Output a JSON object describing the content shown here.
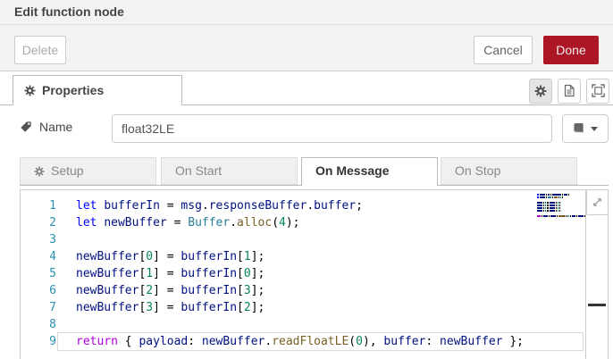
{
  "dialog": {
    "title": "Edit function node"
  },
  "actions": {
    "delete": "Delete",
    "cancel": "Cancel",
    "done": "Done"
  },
  "colors": {
    "done_bg": "#AD1625",
    "header_bg": "#f3f3f3",
    "active_tab_text": "#333",
    "inactive_tab_text": "#888",
    "line_number": "#2b91af"
  },
  "properties": {
    "tab_label": "Properties",
    "icon_buttons": [
      "gear-icon",
      "file-icon",
      "expand-frame-icon"
    ]
  },
  "name_field": {
    "label": "Name",
    "value": "float32LE"
  },
  "function_tabs": [
    {
      "label": "Setup",
      "icon": "gear",
      "active": false
    },
    {
      "label": "On Start",
      "icon": null,
      "active": false
    },
    {
      "label": "On Message",
      "icon": null,
      "active": true
    },
    {
      "label": "On Stop",
      "icon": null,
      "active": false
    }
  ],
  "editor": {
    "language": "javascript",
    "active_line": 9,
    "token_colors": {
      "kw": "#0000ff",
      "ctrl": "#af00db",
      "id": "#001080",
      "cls": "#267f99",
      "fn": "#795e26",
      "num": "#098658",
      "pl": "#000000"
    },
    "lines": [
      {
        "n": 1,
        "tokens": [
          [
            "kw",
            "let"
          ],
          [
            "pl",
            " "
          ],
          [
            "id",
            "bufferIn"
          ],
          [
            "pl",
            " = "
          ],
          [
            "id",
            "msg"
          ],
          [
            "pl",
            "."
          ],
          [
            "id",
            "responseBuffer"
          ],
          [
            "pl",
            "."
          ],
          [
            "id",
            "buffer"
          ],
          [
            "pl",
            ";"
          ]
        ]
      },
      {
        "n": 2,
        "tokens": [
          [
            "kw",
            "let"
          ],
          [
            "pl",
            " "
          ],
          [
            "id",
            "newBuffer"
          ],
          [
            "pl",
            " = "
          ],
          [
            "cls",
            "Buffer"
          ],
          [
            "pl",
            "."
          ],
          [
            "fn",
            "alloc"
          ],
          [
            "pl",
            "("
          ],
          [
            "num",
            "4"
          ],
          [
            "pl",
            ");"
          ]
        ]
      },
      {
        "n": 3,
        "tokens": []
      },
      {
        "n": 4,
        "tokens": [
          [
            "id",
            "newBuffer"
          ],
          [
            "pl",
            "["
          ],
          [
            "num",
            "0"
          ],
          [
            "pl",
            "] = "
          ],
          [
            "id",
            "bufferIn"
          ],
          [
            "pl",
            "["
          ],
          [
            "num",
            "1"
          ],
          [
            "pl",
            "];"
          ]
        ]
      },
      {
        "n": 5,
        "tokens": [
          [
            "id",
            "newBuffer"
          ],
          [
            "pl",
            "["
          ],
          [
            "num",
            "1"
          ],
          [
            "pl",
            "] = "
          ],
          [
            "id",
            "bufferIn"
          ],
          [
            "pl",
            "["
          ],
          [
            "num",
            "0"
          ],
          [
            "pl",
            "];"
          ]
        ]
      },
      {
        "n": 6,
        "tokens": [
          [
            "id",
            "newBuffer"
          ],
          [
            "pl",
            "["
          ],
          [
            "num",
            "2"
          ],
          [
            "pl",
            "] = "
          ],
          [
            "id",
            "bufferIn"
          ],
          [
            "pl",
            "["
          ],
          [
            "num",
            "3"
          ],
          [
            "pl",
            "];"
          ]
        ]
      },
      {
        "n": 7,
        "tokens": [
          [
            "id",
            "newBuffer"
          ],
          [
            "pl",
            "["
          ],
          [
            "num",
            "3"
          ],
          [
            "pl",
            "] = "
          ],
          [
            "id",
            "bufferIn"
          ],
          [
            "pl",
            "["
          ],
          [
            "num",
            "2"
          ],
          [
            "pl",
            "];"
          ]
        ]
      },
      {
        "n": 8,
        "tokens": []
      },
      {
        "n": 9,
        "tokens": [
          [
            "ctrl",
            "return"
          ],
          [
            "pl",
            " { "
          ],
          [
            "id",
            "payload"
          ],
          [
            "pl",
            ": "
          ],
          [
            "id",
            "newBuffer"
          ],
          [
            "pl",
            "."
          ],
          [
            "fn",
            "readFloatLE"
          ],
          [
            "pl",
            "("
          ],
          [
            "num",
            "0"
          ],
          [
            "pl",
            "), "
          ],
          [
            "id",
            "buffer"
          ],
          [
            "pl",
            ": "
          ],
          [
            "id",
            "newBuffer"
          ],
          [
            "pl",
            " };"
          ]
        ]
      }
    ]
  }
}
